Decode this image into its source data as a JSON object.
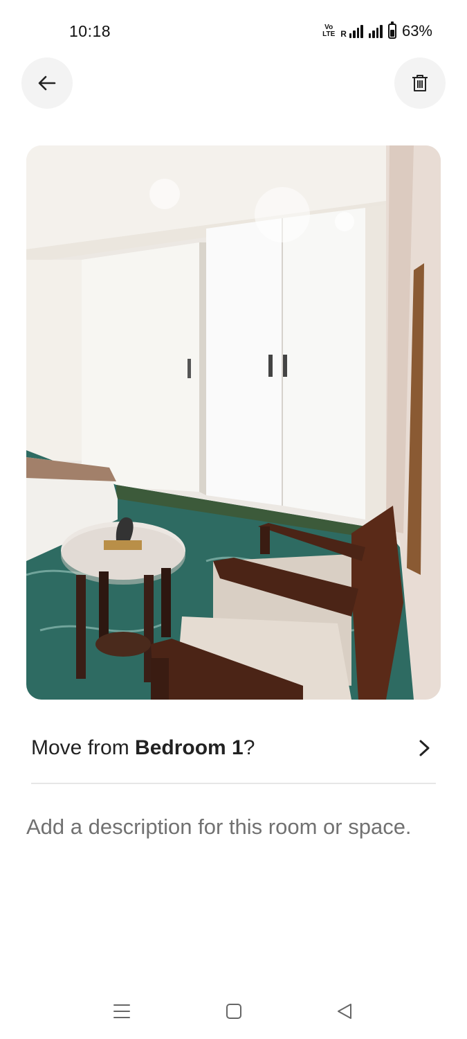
{
  "status_bar": {
    "time": "10:18",
    "network_tag": "Vo LTE",
    "roaming": "R",
    "battery_percent": "63%",
    "battery_level": 0.63
  },
  "header": {
    "back_icon": "arrow-left-icon",
    "delete_icon": "trash-icon"
  },
  "photo": {
    "subject": "bedroom-interior"
  },
  "move_row": {
    "prefix": "Move from ",
    "room_name": "Bedroom 1",
    "suffix": "?",
    "chevron_icon": "chevron-right-icon"
  },
  "description": {
    "placeholder": "Add a description for this room or space."
  },
  "nav_bar": {
    "recents_icon": "menu-lines-icon",
    "home_icon": "square-icon",
    "back_icon": "triangle-back-icon"
  }
}
